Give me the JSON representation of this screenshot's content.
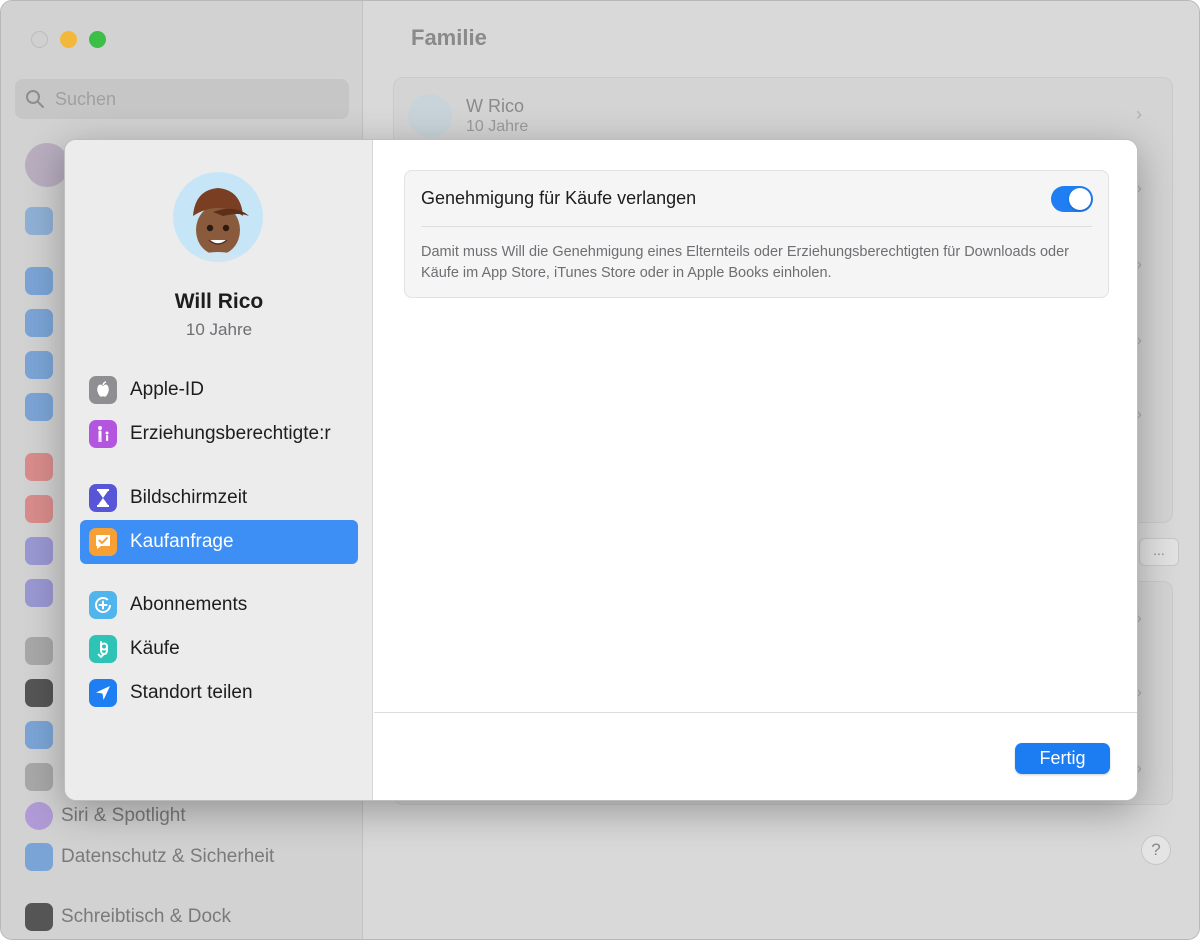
{
  "background": {
    "search": {
      "placeholder": "Suchen"
    },
    "sidebar_visible_items": [
      {
        "label": "Siri & Spotlight",
        "icon": "siri-icon"
      },
      {
        "label": "Datenschutz & Sicherheit",
        "icon": "hand-icon"
      },
      {
        "label": "Schreibtisch & Dock",
        "icon": "dock-icon"
      }
    ],
    "main": {
      "title": "Familie",
      "member": {
        "name": "W Rico",
        "age": "10 Jahre"
      },
      "more_label": "...",
      "help_label": "?"
    }
  },
  "sheet": {
    "profile": {
      "name": "Will Rico",
      "age": "10 Jahre"
    },
    "nav": {
      "group1": [
        {
          "label": "Apple-ID",
          "icon": "apple-icon",
          "color": "#8e8e93"
        },
        {
          "label": "Erziehungsberechtigte:r",
          "icon": "guardian-icon",
          "color": "#b455e0"
        }
      ],
      "group2": [
        {
          "label": "Bildschirmzeit",
          "icon": "hourglass-icon",
          "color": "#5856d6"
        },
        {
          "label": "Kaufanfrage",
          "icon": "ask-to-buy-icon",
          "color": "#f7a035",
          "selected": true
        }
      ],
      "group3": [
        {
          "label": "Abonnements",
          "icon": "subscriptions-icon",
          "color": "#4fb5ec"
        },
        {
          "label": "Käufe",
          "icon": "purchases-icon",
          "color": "#2fc3b5"
        },
        {
          "label": "Standort teilen",
          "icon": "location-icon",
          "color": "#1f7ef2"
        }
      ]
    },
    "setting": {
      "title": "Genehmigung für Käufe verlangen",
      "toggle_on": true,
      "description": "Damit muss Will die Genehmigung eines Elternteils oder Erziehungsberechtigten für Downloads oder Käufe im App Store, iTunes Store oder in Apple Books einholen."
    },
    "footer": {
      "done_label": "Fertig"
    }
  },
  "colors": {
    "accent": "#1f7ef2",
    "selection": "#3d8ff5"
  }
}
